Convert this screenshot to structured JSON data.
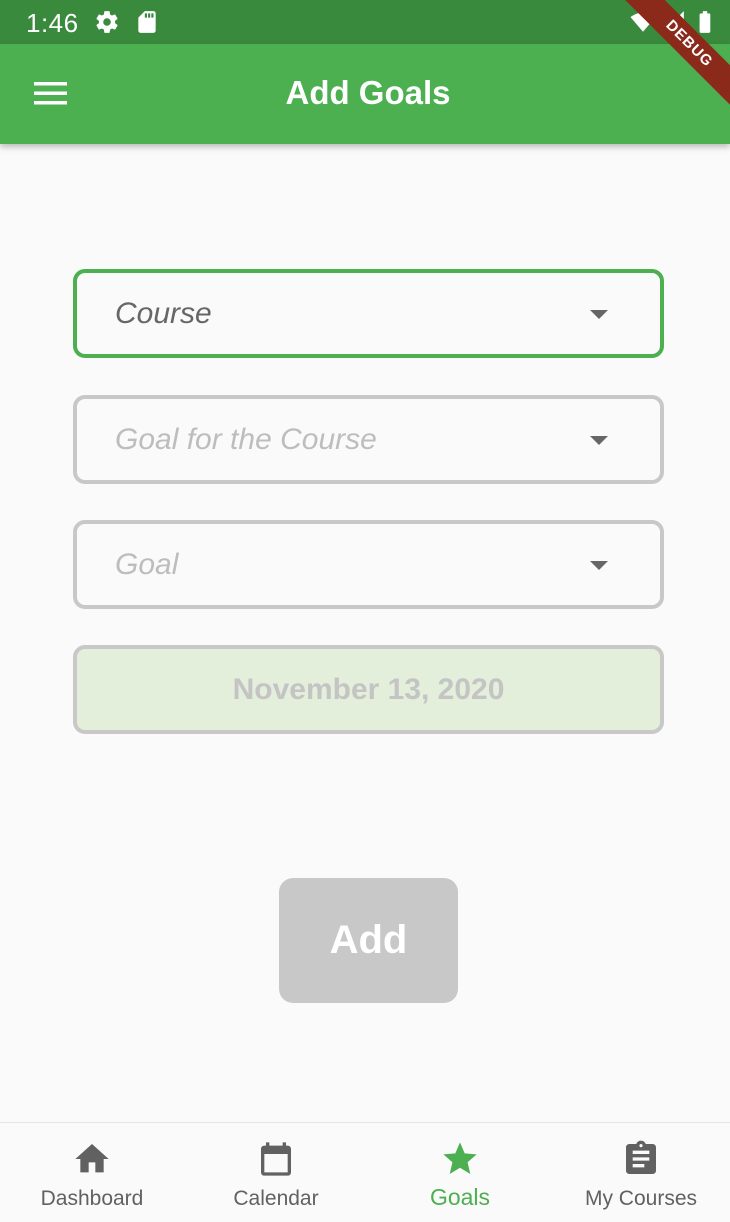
{
  "status_bar": {
    "time": "1:46",
    "icons": [
      "settings-icon",
      "sd-card-icon",
      "wifi-icon",
      "signal-icon",
      "battery-icon"
    ]
  },
  "app_bar": {
    "title": "Add Goals",
    "menu_icon": "hamburger-menu-icon",
    "color": "#4caf50"
  },
  "debug_banner": "DEBUG",
  "form": {
    "course_dropdown": {
      "label": "Course"
    },
    "goal_for_course_dropdown": {
      "label": "Goal for the Course"
    },
    "goal_dropdown": {
      "label": "Goal"
    },
    "date": {
      "value": "November 13, 2020"
    },
    "add_button": {
      "label": "Add"
    }
  },
  "bottom_nav": {
    "items": [
      {
        "label": "Dashboard",
        "icon": "home-icon",
        "active": false
      },
      {
        "label": "Calendar",
        "icon": "calendar-icon",
        "active": false
      },
      {
        "label": "Goals",
        "icon": "star-icon",
        "active": true
      },
      {
        "label": "My Courses",
        "icon": "clipboard-icon",
        "active": false
      }
    ],
    "active_color": "#4caf50",
    "inactive_color": "#616161"
  }
}
